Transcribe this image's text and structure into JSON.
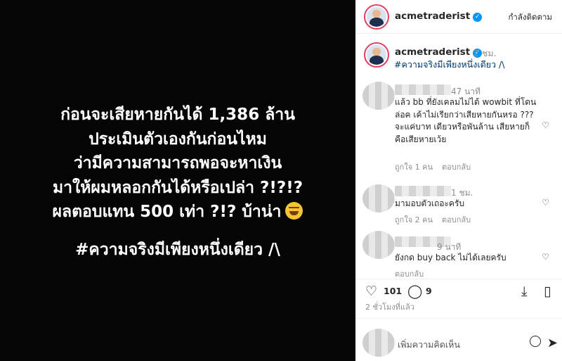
{
  "post": {
    "lines": [
      "ก่อนจะเสียหายกันได้ 1,386 ล้าน",
      "ประเมินตัวเองกันก่อนไหม",
      "ว่ามีความสามารถพอจะหาเงิน",
      "มาให้ผมหลอกกันได้หรือเปล่า ?!?!?",
      "ผลตอบแทน 500 เท่า ?!? บ้าน่า"
    ],
    "hashtag": "#ความจริงมีเพียงหนึ่งเดียว /\\"
  },
  "header": {
    "username": "acmetraderist",
    "verified_mark": "✓",
    "following_label": "กำลังติดตาม"
  },
  "caption": {
    "username": "acmetraderist",
    "time": "2 ชม.",
    "hashtag": "#ความจริงมีเพียงหนึ่งเดียว /\\"
  },
  "comments": [
    {
      "time": "47 นาที",
      "text": "แล้ว bb ที่ยังเคลมไม่ได้ wowbit ที่โดนล่อค เค้าไม่เรียกว่าเสียหายกันหรอ ??? จะแค่บาท เดียวหรือพันล้าน เสียหายก็คือเสียหายเว้ย",
      "likes": "ถูกใจ 1 คน",
      "reply": "ตอบกลับ"
    },
    {
      "time": "1 ชม.",
      "text": "มามอบตัวเถอะครับ",
      "likes": "ถูกใจ 2 คน",
      "reply": "ตอบกลับ"
    },
    {
      "time": "9 นาที",
      "text": "ยังกด buy back ไม่ได้เลยครับ",
      "likes": "",
      "reply": "ตอบกลับ"
    }
  ],
  "actions": {
    "like_count": "101",
    "comment_count": "9",
    "posted_ago": "2 ชั่วโมงที่แล้ว"
  },
  "composer": {
    "placeholder": "เพิ่มความคิดเห็น"
  },
  "icons": {
    "like": "heart-icon",
    "comment": "comment-icon",
    "save": "bookmark-icon",
    "share": "share-icon",
    "send": "send-icon"
  }
}
